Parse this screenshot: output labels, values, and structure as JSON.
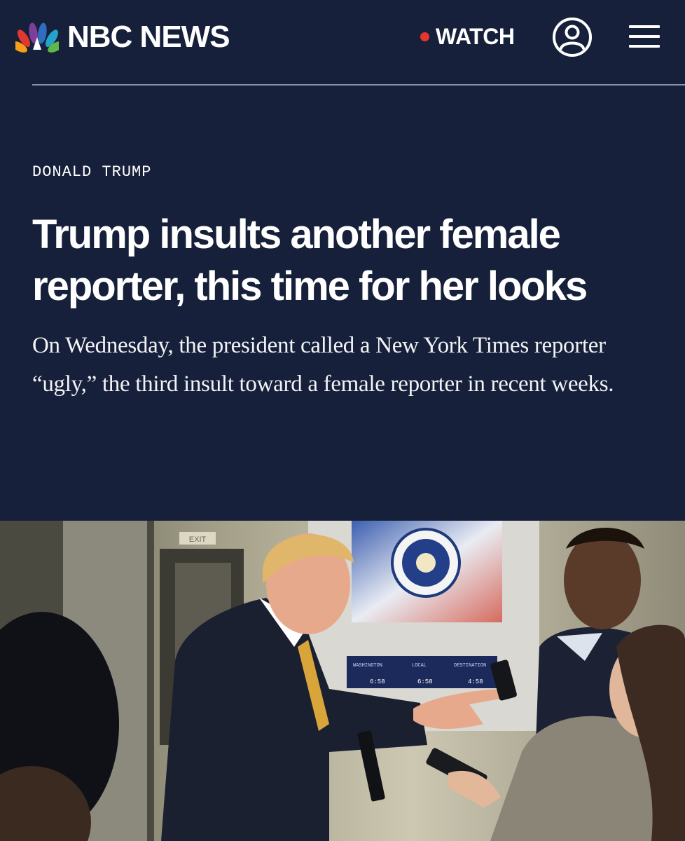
{
  "header": {
    "logo_text": "NBC NEWS",
    "logo_icon": "nbc-peacock-icon",
    "watch_label": "WATCH",
    "live_color": "#e8352b",
    "account_icon": "user-account-icon",
    "menu_icon": "hamburger-menu-icon",
    "background_color": "#16203a"
  },
  "article": {
    "kicker": "DONALD TRUMP",
    "headline": "Trump insults another female reporter, this time for her looks",
    "dek": "On Wednesday, the president called a New York Times reporter “ugly,” the third insult toward a female reporter in recent weeks."
  },
  "photo": {
    "panel_labels": [
      "WASHINGTON",
      "LOCAL",
      "DESTINATION"
    ],
    "panel_times": [
      "6:58",
      "6:58",
      "4:58"
    ],
    "exit_sign": "EXIT"
  }
}
